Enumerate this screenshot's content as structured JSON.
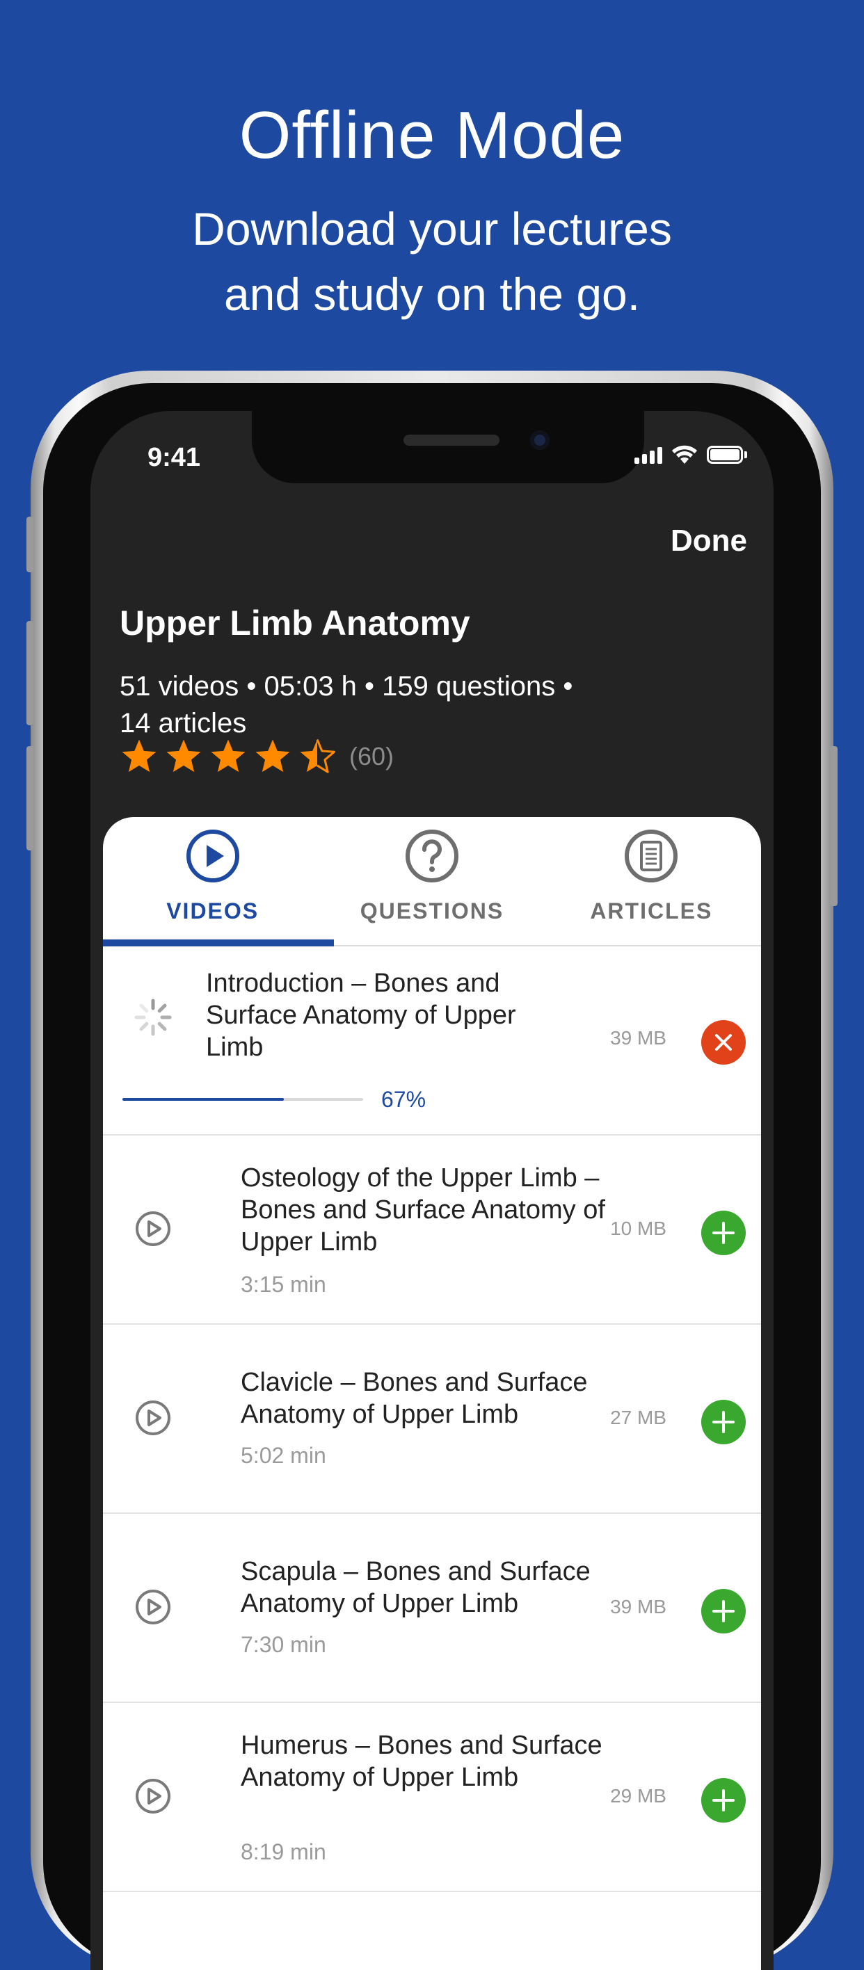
{
  "headline": {
    "title": "Offline Mode",
    "subtitle_line1": "Download your lectures",
    "subtitle_line2": "and study on the go."
  },
  "status_bar": {
    "time": "9:41"
  },
  "nav": {
    "done_label": "Done"
  },
  "course": {
    "title": "Upper Limb Anatomy",
    "meta_line1": "51 videos • 05:03 h • 159 questions •",
    "meta_line2": "14 articles",
    "rating": 4.5,
    "rating_count": "(60)",
    "star_color": "#ff8a00"
  },
  "tabs": [
    {
      "label": "VIDEOS",
      "icon": "play-circle-icon",
      "active": true
    },
    {
      "label": "QUESTIONS",
      "icon": "question-circle-icon",
      "active": false
    },
    {
      "label": "ARTICLES",
      "icon": "document-circle-icon",
      "active": false
    }
  ],
  "videos": [
    {
      "title": "Introduction – Bones and Surface Anatomy of Upper Limb",
      "size": "39 MB",
      "status": "downloading",
      "progress": 0.67,
      "progress_label": "67%"
    },
    {
      "title": "Osteology of the Upper Limb – Bones and Surface Anatomy of Upper Limb",
      "duration": "3:15 min",
      "size": "10 MB",
      "status": "available"
    },
    {
      "title": "Clavicle – Bones and Surface Anatomy of Upper Limb",
      "duration": "5:02 min",
      "size": "27 MB",
      "status": "available"
    },
    {
      "title": "Scapula – Bones and Surface Anatomy of Upper Limb",
      "duration": "7:30 min",
      "size": "39 MB",
      "status": "available"
    },
    {
      "title": "Humerus – Bones and Surface Anatomy of Upper Limb",
      "duration": "8:19 min",
      "size": "29 MB",
      "status": "available"
    }
  ],
  "colors": {
    "background": "#1d4aa0",
    "accent": "#1d4aa0",
    "add": "#3aa72f",
    "cancel": "#e24219"
  }
}
